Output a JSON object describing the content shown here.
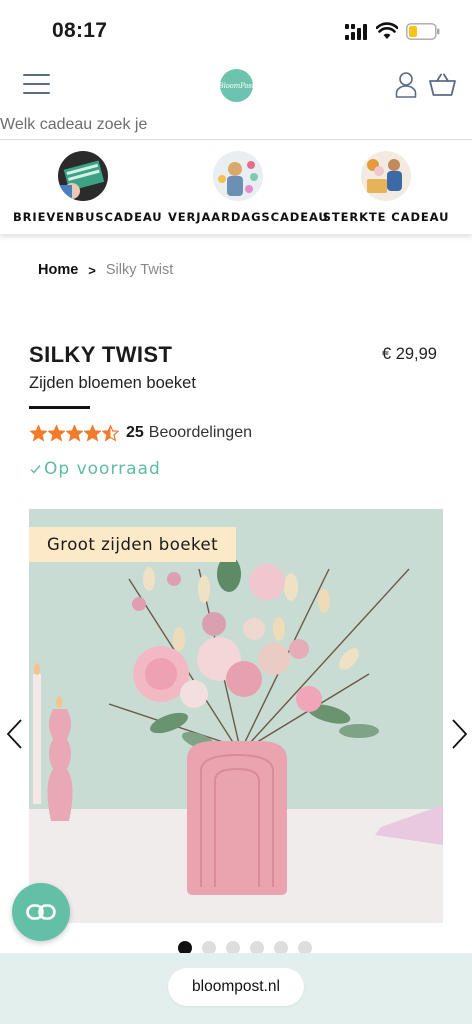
{
  "status_bar": {
    "time": "08:17",
    "icons": [
      "signal-icon",
      "wifi-icon",
      "battery-icon"
    ],
    "battery_color": "#f5c518"
  },
  "header": {
    "logo_text": "BloomPost",
    "icons": [
      "menu-icon",
      "user-icon",
      "cart-icon"
    ],
    "brand_color": "#6cc3ae"
  },
  "search": {
    "placeholder": "Welk cadeau zoek je"
  },
  "categories": [
    {
      "label": "BRIEVENBUSCADEAU"
    },
    {
      "label": "VERJAARDAGSCADEAU"
    },
    {
      "label": "STERKTE CADEAU"
    }
  ],
  "breadcrumb": {
    "home": "Home",
    "separator": ">",
    "current": "Silky Twist"
  },
  "product": {
    "title": "SILKY TWIST",
    "price": "€ 29,99",
    "subtitle": "Zijden bloemen boeket",
    "rating_value": 4.5,
    "rating_max": 5,
    "rating_count": "25",
    "rating_label": "Beoordelingen",
    "stock": "Op voorraad",
    "star_color": "#f07b2b",
    "stock_color": "#5fbba1"
  },
  "gallery": {
    "badge": "Groot zijden boeket",
    "slide_count": 6,
    "active_slide": 1
  },
  "chat": {
    "icon": "chat-link-icon"
  },
  "browser": {
    "url": "bloompost.nl"
  }
}
